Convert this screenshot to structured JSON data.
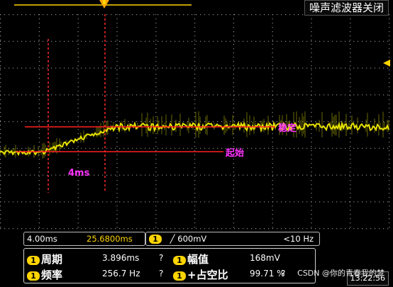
{
  "header": {
    "title": "噪声滤波器关闭"
  },
  "annotations": {
    "steady": "稳定",
    "start": "起始",
    "time_delta": "4ms"
  },
  "status": {
    "timebase": "4.00ms",
    "delay": "25.6800ms",
    "trigger_channel": "1",
    "trigger_level": "600mV",
    "trigger_freq": "<10 Hz"
  },
  "measurements": [
    {
      "channel": "1",
      "label": "周期",
      "value": "3.896ms",
      "flag": "?"
    },
    {
      "channel": "1",
      "label": "幅值",
      "value": "168mV",
      "flag": ""
    },
    {
      "channel": "1",
      "label": "频率",
      "value": "256.7 Hz",
      "flag": "?"
    },
    {
      "channel": "1",
      "label": "+占空比",
      "value": "99.71 %",
      "flag": "?"
    }
  ],
  "footer": {
    "watermark": "CSDN @你的青春我的梦",
    "clock": "13:22:56"
  },
  "colors": {
    "trace": "#d9d400",
    "grid": "#7a7a7a",
    "annotation_line": "#ff2020",
    "annotation_text": "#ff33ff",
    "trigger": "#ffa500"
  }
}
